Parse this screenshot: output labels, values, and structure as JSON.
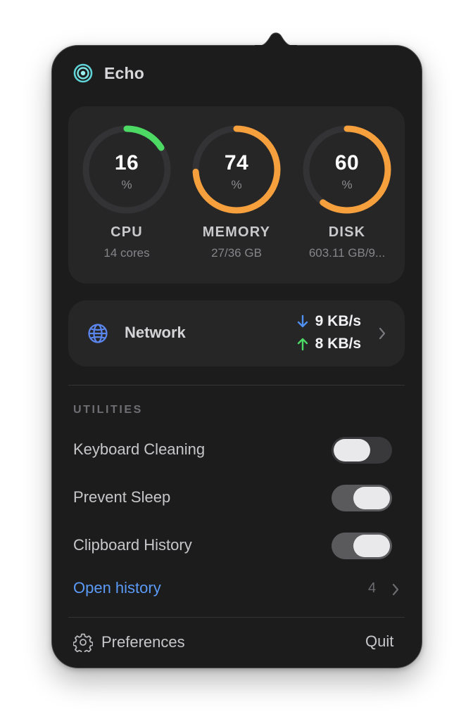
{
  "app": {
    "title": "Echo",
    "icon": "echo-logo-icon"
  },
  "gauges": [
    {
      "id": "cpu",
      "value": "16",
      "unit": "%",
      "label": "CPU",
      "sub": "14 cores",
      "percent": 16,
      "color": "#4cd964"
    },
    {
      "id": "memory",
      "value": "74",
      "unit": "%",
      "label": "MEMORY",
      "sub": "27/36 GB",
      "percent": 74,
      "color": "#f6a03d"
    },
    {
      "id": "disk",
      "value": "60",
      "unit": "%",
      "label": "DISK",
      "sub": "603.11 GB/9...",
      "percent": 60,
      "color": "#f6a03d"
    }
  ],
  "network": {
    "label": "Network",
    "icon": "globe-icon",
    "download": "9 KB/s",
    "upload": "8 KB/s",
    "download_color": "#4f8ff0",
    "upload_color": "#4cd964"
  },
  "utilities": {
    "title": "UTILITIES",
    "items": [
      {
        "label": "Keyboard Cleaning",
        "enabled": false
      },
      {
        "label": "Prevent Sleep",
        "enabled": true
      },
      {
        "label": "Clipboard History",
        "enabled": true
      }
    ],
    "open_history_label": "Open history",
    "history_count": "4"
  },
  "footer": {
    "preferences_label": "Preferences",
    "quit_label": "Quit"
  },
  "colors": {
    "panel": "#1c1c1d",
    "card": "#262627",
    "track": "#333335",
    "accent_link": "#5b9af6"
  }
}
